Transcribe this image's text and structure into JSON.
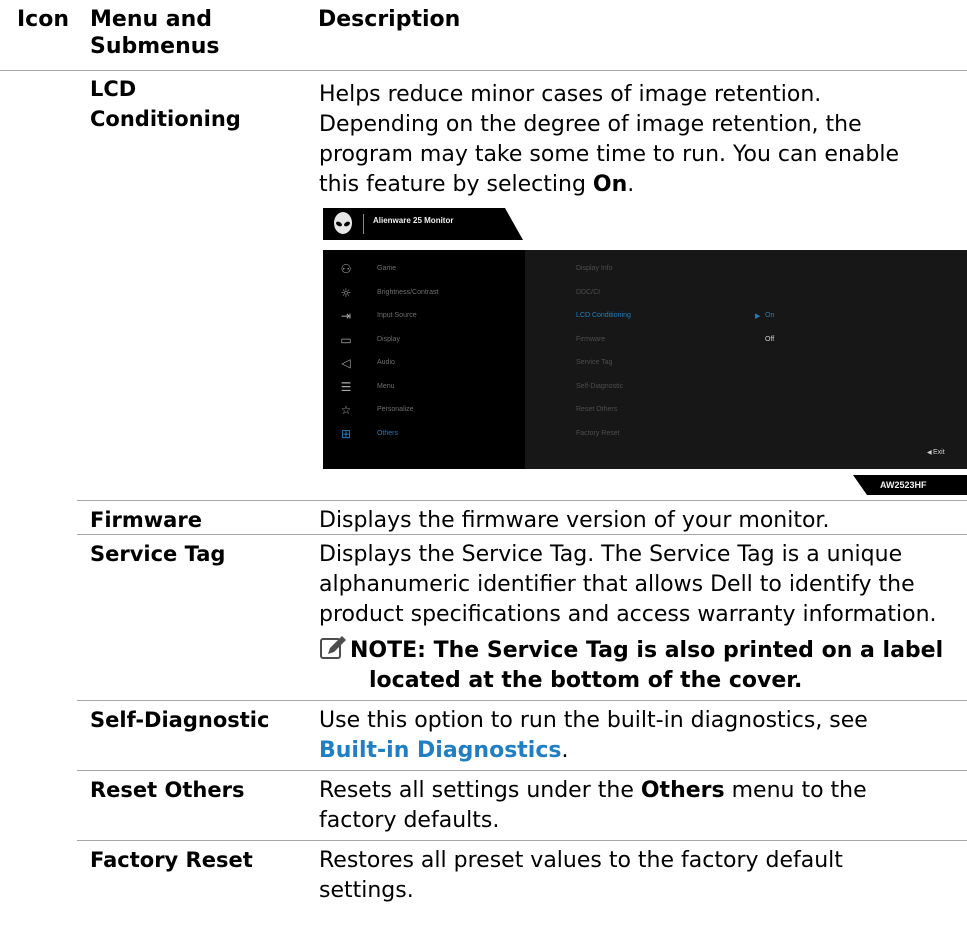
{
  "header": {
    "col_icon": "Icon",
    "col_menu_line1": "Menu and",
    "col_menu_line2": "Submenus",
    "col_desc": "Description"
  },
  "lcd": {
    "name_line1": "LCD",
    "name_line2": "Conditioning",
    "desc_lines": [
      "Helps reduce minor cases of image retention.",
      "Depending on the degree of image retention, the",
      "program may take some time to run. You can enable",
      "this feature by selecting "
    ],
    "desc_bold": "On",
    "desc_end": "."
  },
  "osd": {
    "title": "Alienware 25 Monitor",
    "model": "AW2523HF",
    "exit_label": "Exit",
    "accent": "#1f7fc2",
    "menu": [
      {
        "icon": "game-icon",
        "label": "Game"
      },
      {
        "icon": "brightness-icon",
        "label": "Brightness/Contrast"
      },
      {
        "icon": "input-source-icon",
        "label": "Input Source"
      },
      {
        "icon": "display-icon",
        "label": "Display"
      },
      {
        "icon": "audio-icon",
        "label": "Audio"
      },
      {
        "icon": "menu-icon",
        "label": "Menu"
      },
      {
        "icon": "star-icon",
        "label": "Personalize"
      },
      {
        "icon": "others-icon",
        "label": "Others"
      }
    ],
    "submenu": [
      "Display Info",
      "DDC/CI",
      "LCD Conditioning",
      "Firmware",
      "Service Tag",
      "Self-Diagnostic",
      "Reset Others",
      "Factory Reset"
    ],
    "option_on": "On",
    "option_off": "Off"
  },
  "rows": {
    "firmware": {
      "name": "Firmware",
      "desc": "Displays the firmware version of your monitor."
    },
    "service_tag": {
      "name": "Service Tag",
      "desc_lines": [
        "Displays the Service Tag. The Service Tag is a unique",
        "alphanumeric identifier that allows Dell to identify the",
        "product specifications and access warranty information."
      ],
      "note_line1": "NOTE: The Service Tag is also printed on a label",
      "note_line2": "located at the bottom of the cover."
    },
    "self_diag": {
      "name": "Self-Diagnostic",
      "desc_line1": "Use this option to run the built-in diagnostics, see",
      "link": "Built-in Diagnostics",
      "link_end": "."
    },
    "reset_others": {
      "name": "Reset Others",
      "desc_pre": "Resets all settings under the ",
      "desc_bold": "Others",
      "desc_post": " menu to the",
      "desc_line2": "factory defaults."
    },
    "factory_reset": {
      "name": "Factory Reset",
      "desc_line1": "Restores all preset values to the factory default",
      "desc_line2": "settings."
    }
  }
}
